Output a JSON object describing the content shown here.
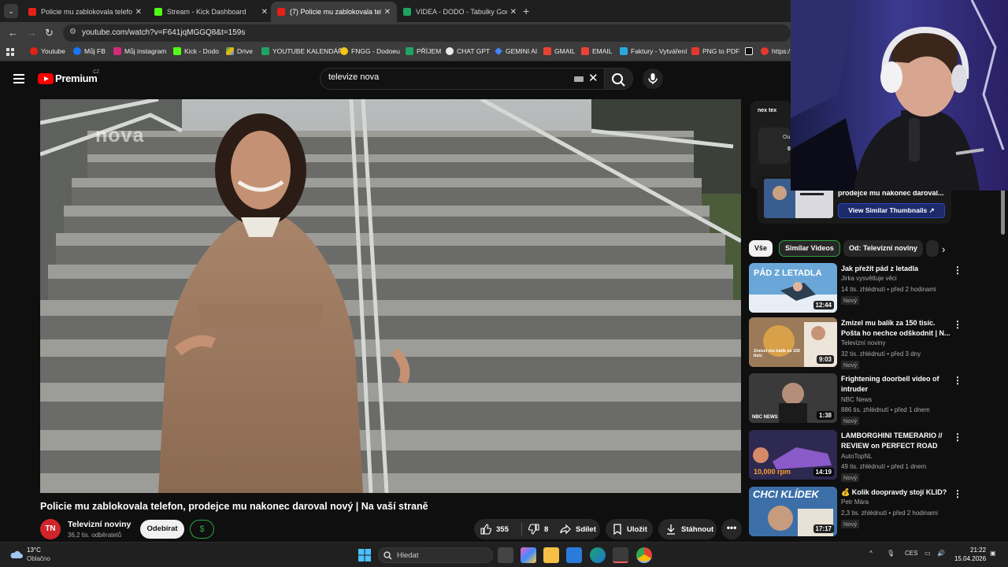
{
  "browser": {
    "tabs": [
      {
        "title": "Policie mu zablokovala telefon,",
        "active": false
      },
      {
        "title": "Stream - Kick Dashboard",
        "active": false
      },
      {
        "title": "(7) Policie mu zablokovala telef",
        "active": true
      },
      {
        "title": "VIDEA - DODO - Tabulky Googl",
        "active": false
      }
    ],
    "url": "youtube.com/watch?v=F641jqMGGQ8&t=159s",
    "bookmarks": [
      "Youtube",
      "Můj FB",
      "Můj instagram",
      "Kick - Dodo",
      "Drive",
      "YOUTUBE KALENDÁŘ",
      "FNGG - Dodoeu",
      "PŘÍJEM",
      "CHAT GPT",
      "GEMINI AI",
      "GMAIL",
      "EMAIL",
      "Faktury - Vytváření",
      "PNG to PDF",
      "https:/"
    ]
  },
  "youtube": {
    "brand": "Premium",
    "country": "CZ",
    "search_query": "televize nova",
    "video": {
      "watermark": "nova",
      "title": "Policie mu zablokovala telefon, prodejce mu nakonec daroval nový | Na vaší straně",
      "channel": "Televizní noviny",
      "channel_initials": "TN",
      "subscribers": "36,2 tis. odběratelů",
      "subscribe_label": "Odebírat",
      "thanks_icon": "$",
      "likes": "355",
      "dislikes": "8",
      "share_label": "Sdílet",
      "save_label": "Uložit",
      "download_label": "Stáhnout",
      "more": "•••"
    },
    "sidebar": {
      "next_logo": "nex tex",
      "card_line1": "Ou",
      "card_line2": "0",
      "similar_text": "prodejce mu nakonec daroval...",
      "similar_button": "View Similar Thumbnails ↗",
      "chips": [
        "Vše",
        "Similar Videos",
        "Od: Televizní noviny",
        ""
      ],
      "recommendations": [
        {
          "title": "Jak přežít pád z letadla",
          "channel": "Jirka vysvětluje věci",
          "meta": "14 tis. zhlédnutí • před 2 hodinami",
          "badge": "Nový",
          "duration": "12:44",
          "thumb_text": "PÁD Z LETADLA"
        },
        {
          "title": "Zmizel mu balík za 150 tisíc. Pošta ho nechce odškodnit | N...",
          "channel": "Televizní noviny",
          "meta": "32 tis. zhlédnutí • před 3 dny",
          "badge": "Nový",
          "duration": "9:03",
          "thumb_text": "Zmizel mu balík za 150 tisíc"
        },
        {
          "title": "Frightening doorbell video of intruder",
          "channel": "NBC News",
          "meta": "886 tis. zhlédnutí • před 1 dnem",
          "badge": "Nový",
          "duration": "1:38",
          "thumb_text": "NBC NEWS"
        },
        {
          "title": "LAMBORGHINI TEMERARIO // REVIEW on PERFECT ROAD",
          "channel": "AutoTopNL",
          "meta": "49 tis. zhlédnutí • před 1 dnem",
          "badge": "Nový",
          "duration": "14:19",
          "thumb_text": "10,000 rpm"
        },
        {
          "title": "💰 Kolik doopravdy stojí KLID?",
          "channel": "Petr Mára",
          "meta": "2,3 tis. zhlédnutí • před 2 hodinami",
          "badge": "Nový",
          "duration": "17:17",
          "thumb_text": "CHCI KLÍDEK"
        }
      ]
    }
  },
  "taskbar": {
    "temperature": "13°C",
    "condition": "Oblačno",
    "search_placeholder": "Hledat",
    "language": "CES",
    "time": "21:22",
    "date": "15.04.2026"
  },
  "colors": {
    "youtube_red": "#ff0000",
    "subscribe_bg": "#f1f1f1",
    "thanks_green": "#2ba640",
    "view_similar_blue": "#2d46b9"
  }
}
